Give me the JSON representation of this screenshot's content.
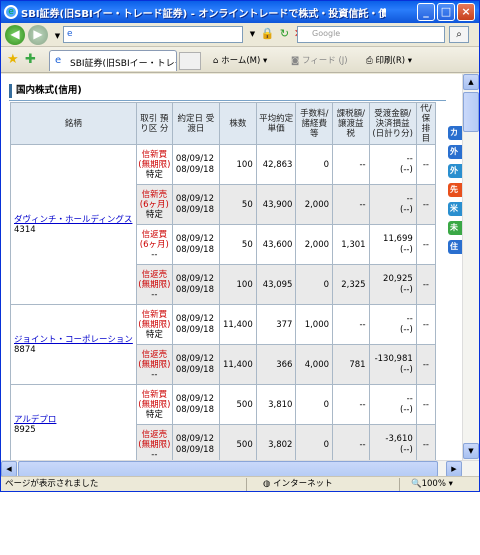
{
  "window": {
    "title": "SBI証券(旧SBIイー・トレード証券) - オンライントレードで株式・投資信託・債券を - Wind...",
    "minimize": "_",
    "maximize": "□",
    "close": "×"
  },
  "address": {
    "url_prefix": "e",
    "search_placeholder": "Google"
  },
  "toolbar": {
    "tab_label": "SBI証券(旧SBIイー・トレー...",
    "home": "ホーム(M)",
    "feed": "フィード (J)",
    "print": "印刷(R)"
  },
  "section": {
    "title": "国内株式(信用)"
  },
  "table": {
    "headers": [
      "銘柄",
      "取引 預り区 分",
      "約定日 受渡日",
      "株数",
      "平均約定 単価",
      "手数料/ 諸経費等",
      "課税額/ 譲渡益税",
      "受渡金額/ 決済損益 (日計り分)",
      "代/保 排目"
    ],
    "groups": [
      {
        "name": "ダヴィンチ・ホールディングス",
        "code": "4314",
        "rows": [
          {
            "type": "信新買",
            "term": "(無期限)",
            "acct": "特定",
            "trade_date": "08/09/12",
            "settle_date": "08/09/18",
            "qty": "100",
            "price": "42,863",
            "fee": "0",
            "tax": "--",
            "amount": "--",
            "amount_sub": "(--)",
            "misc": "--"
          },
          {
            "type": "信新売",
            "term": "(6ヶ月)",
            "acct": "特定",
            "trade_date": "08/09/12",
            "settle_date": "08/09/18",
            "qty": "50",
            "price": "43,900",
            "fee": "2,000",
            "tax": "--",
            "amount": "--",
            "amount_sub": "(--)",
            "misc": "--"
          },
          {
            "type": "信返買",
            "term": "(6ヶ月)",
            "acct": "--",
            "trade_date": "08/09/12",
            "settle_date": "08/09/18",
            "qty": "50",
            "price": "43,600",
            "fee": "2,000",
            "tax": "1,301",
            "amount": "11,699",
            "amount_sub": "(--)",
            "misc": "--"
          },
          {
            "type": "信返売",
            "term": "(無期限)",
            "acct": "--",
            "trade_date": "08/09/12",
            "settle_date": "08/09/18",
            "qty": "100",
            "price": "43,095",
            "fee": "0",
            "tax": "2,325",
            "amount": "20,925",
            "amount_sub": "(--)",
            "misc": "--"
          }
        ]
      },
      {
        "name": "ジョイント・コーポレーション",
        "code": "8874",
        "rows": [
          {
            "type": "信新買",
            "term": "(無期限)",
            "acct": "特定",
            "trade_date": "08/09/12",
            "settle_date": "08/09/18",
            "qty": "11,400",
            "price": "377",
            "fee": "1,000",
            "tax": "--",
            "amount": "--",
            "amount_sub": "(--)",
            "misc": "--"
          },
          {
            "type": "信返売",
            "term": "(無期限)",
            "acct": "--",
            "trade_date": "08/09/12",
            "settle_date": "08/09/18",
            "qty": "11,400",
            "price": "366",
            "fee": "4,000",
            "tax": "781",
            "amount": "-130,981",
            "amount_sub": "(--)",
            "misc": "--"
          }
        ]
      },
      {
        "name": "アルデプロ",
        "code": "8925",
        "rows": [
          {
            "type": "信新買",
            "term": "(無期限)",
            "acct": "特定",
            "trade_date": "08/09/12",
            "settle_date": "08/09/18",
            "qty": "500",
            "price": "3,810",
            "fee": "0",
            "tax": "--",
            "amount": "--",
            "amount_sub": "(--)",
            "misc": "--"
          },
          {
            "type": "信返売",
            "term": "(無期限)",
            "acct": "--",
            "trade_date": "08/09/12",
            "settle_date": "08/09/18",
            "qty": "500",
            "price": "3,802",
            "fee": "0",
            "tax": "--",
            "amount": "-3,610",
            "amount_sub": "(--)",
            "misc": "--"
          }
        ]
      }
    ]
  },
  "side_panel": {
    "items": [
      "カ",
      "外",
      "外",
      "先",
      "米",
      "未",
      "住"
    ],
    "item_colors": [
      "#2a6fcf",
      "#2a6fcf",
      "#2a8fcf",
      "#e8501c",
      "#2a8fcf",
      "#3aa845",
      "#2a6fcf"
    ]
  },
  "status": {
    "message": "ページが表示されました",
    "zone": "インターネット",
    "zoom": "100%"
  }
}
